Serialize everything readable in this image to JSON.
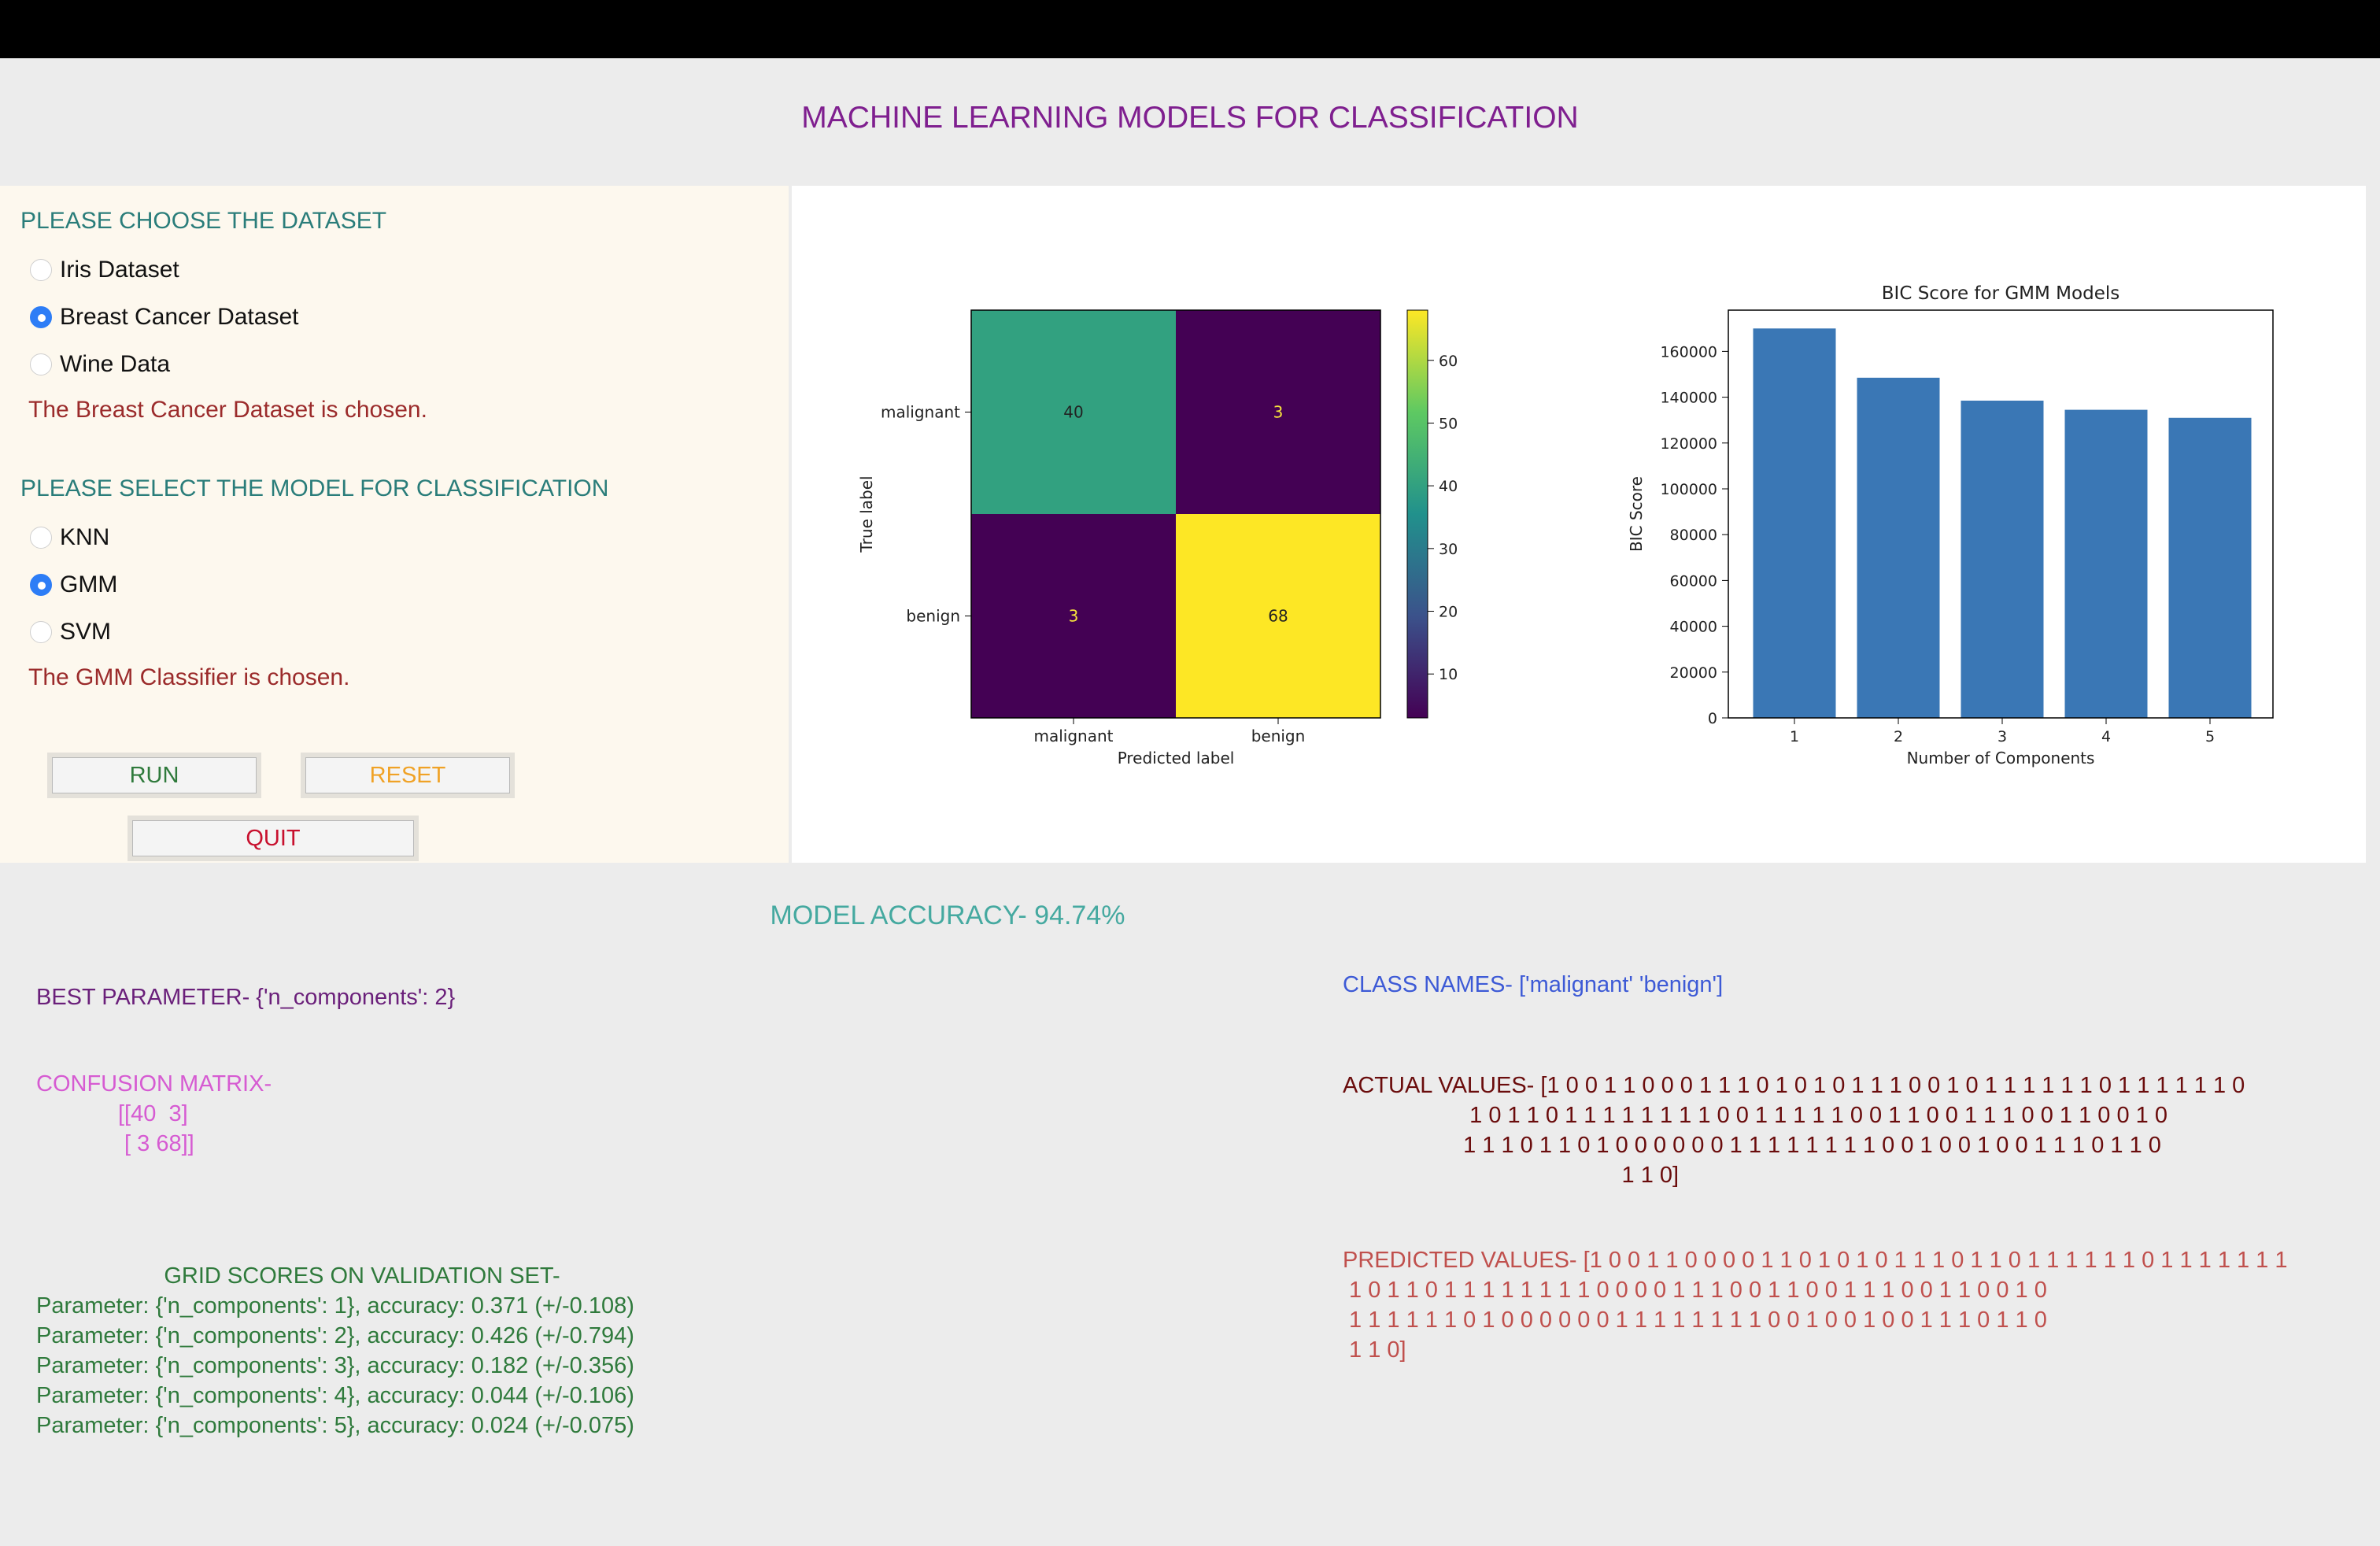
{
  "app": {
    "title": "MACHINE LEARNING MODELS FOR CLASSIFICATION"
  },
  "dataset": {
    "heading": "PLEASE CHOOSE THE DATASET",
    "options": [
      {
        "label": "Iris Dataset",
        "checked": false
      },
      {
        "label": "Breast Cancer Dataset",
        "checked": true
      },
      {
        "label": "Wine Data",
        "checked": false
      }
    ],
    "status": "The Breast Cancer Dataset is chosen."
  },
  "model": {
    "heading": "PLEASE SELECT THE MODEL FOR CLASSIFICATION",
    "options": [
      {
        "label": "KNN",
        "checked": false
      },
      {
        "label": "GMM",
        "checked": true
      },
      {
        "label": "SVM",
        "checked": false
      }
    ],
    "status": "The GMM Classifier is chosen."
  },
  "buttons": {
    "run": "RUN",
    "reset": "RESET",
    "quit": "QUIT",
    "run_color": "#2f7a3c",
    "reset_color": "#f0a226",
    "quit_color": "#c8102e"
  },
  "results": {
    "accuracy": "MODEL ACCURACY- 94.74%",
    "best_parameter": "BEST PARAMETER-  {'n_components': 2}",
    "confusion_label": "CONFUSION MATRIX-",
    "confusion_rows": [
      "[[40  3]",
      " [ 3 68]]"
    ],
    "grid_title": "GRID SCORES ON VALIDATION SET-",
    "grid_scores": [
      "Parameter: {'n_components': 1}, accuracy: 0.371 (+/-0.108)",
      "Parameter: {'n_components': 2}, accuracy: 0.426 (+/-0.794)",
      "Parameter: {'n_components': 3}, accuracy: 0.182 (+/-0.356)",
      "Parameter: {'n_components': 4}, accuracy: 0.044 (+/-0.106)",
      "Parameter: {'n_components': 5}, accuracy: 0.024 (+/-0.075)"
    ],
    "class_names": "CLASS NAMES- ['malignant' 'benign']",
    "actual_values": "ACTUAL VALUES- [1 0 0 1 1 0 0 0 1 1 1 0 1 0 1 0 1 1 1 0 0 1 0 1 1 1 1 1 1 0 1 1 1 1 1 1 0\n                    1 0 1 1 0 1 1 1 1 1 1 1 1 0 0 1 1 1 1 1 0 0 1 1 0 0 1 1 1 0 0 1 1 0 0 1 0\n                   1 1 1 0 1 1 0 1 0 0 0 0 0 0 1 1 1 1 1 1 1 1 0 0 1 0 0 1 0 0 1 1 1 0 1 1 0\n                                            1 1 0]",
    "predicted_values": "PREDICTED VALUES- [1 0 0 1 1 0 0 0 0 1 1 0 1 0 1 0 1 1 1 0 1 1 0 1 1 1 1 1 1 0 1 1 1 1 1 1 1\n 1 0 1 1 0 1 1 1 1 1 1 1 1 0 0 0 0 1 1 1 0 0 1 1 0 0 1 1 1 0 0 1 1 0 0 1 0\n 1 1 1 1 1 1 0 1 0 0 0 0 0 0 1 1 1 1 1 1 1 1 0 0 1 0 0 1 0 0 1 1 1 0 1 1 0\n 1 1 0]"
  },
  "chart_data": [
    {
      "type": "heatmap",
      "title": "",
      "xlabel": "Predicted label",
      "ylabel": "True label",
      "x_categories": [
        "malignant",
        "benign"
      ],
      "y_categories": [
        "malignant",
        "benign"
      ],
      "values": [
        [
          40,
          3
        ],
        [
          3,
          68
        ]
      ],
      "colorbar_ticks": [
        10,
        20,
        30,
        40,
        50,
        60
      ],
      "colormap": "viridis"
    },
    {
      "type": "bar",
      "title": "BIC Score for GMM Models",
      "xlabel": "Number of Components",
      "ylabel": "BIC Score",
      "categories": [
        "1",
        "2",
        "3",
        "4",
        "5"
      ],
      "values": [
        170000,
        148500,
        138500,
        134500,
        131000
      ],
      "ylim": [
        0,
        178000
      ],
      "yticks": [
        0,
        20000,
        40000,
        60000,
        80000,
        100000,
        120000,
        140000,
        160000
      ],
      "color": "#3a77b5"
    }
  ]
}
